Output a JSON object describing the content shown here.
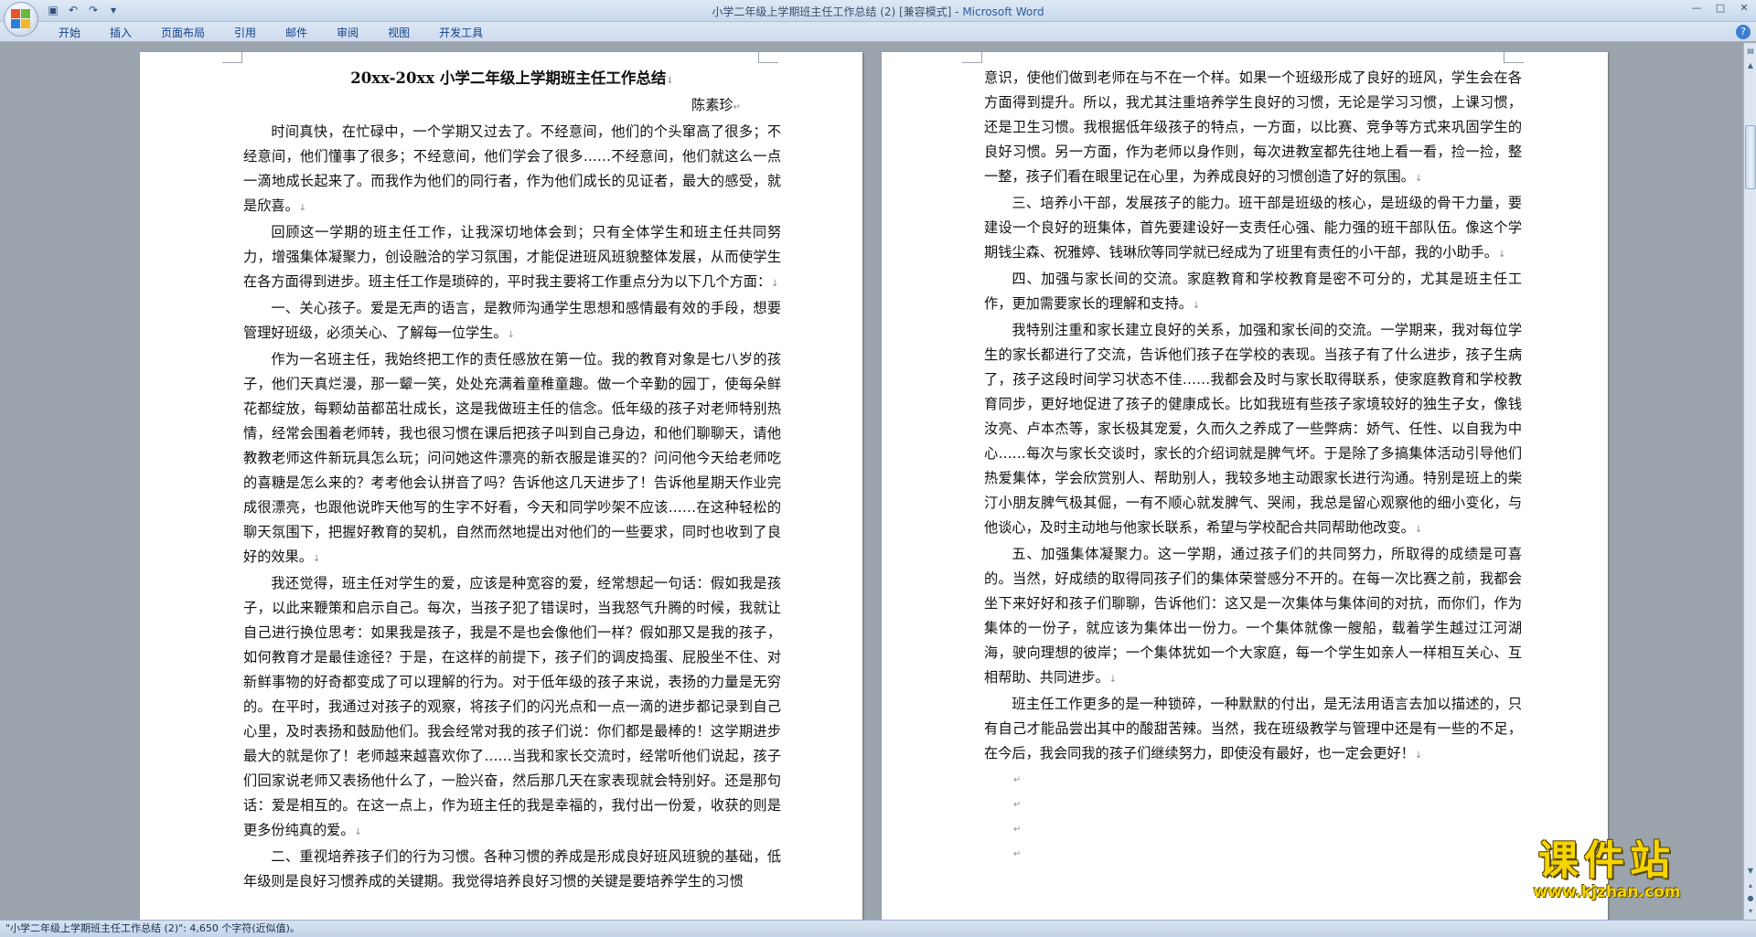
{
  "window": {
    "title_doc": "小学二年级上学期班主任工作总结 (2) [兼容模式] - ",
    "title_app": "Microsoft Word"
  },
  "ribbon": {
    "tabs": [
      "开始",
      "插入",
      "页面布局",
      "引用",
      "邮件",
      "审阅",
      "视图",
      "开发工具"
    ]
  },
  "document": {
    "title": "20xx-20xx 小学二年级上学期班主任工作总结",
    "author": "陈素珍",
    "left_paragraphs": [
      {
        "text": "时间真快，在忙碌中，一个学期又过去了。不经意间，他们的个头窜高了很多；不经意间，他们懂事了很多；不经意间，他们学会了很多……不经意间，他们就这么一点一滴地成长起来了。而我作为他们的同行者，作为他们成长的见证者，最大的感受，就是欣喜。",
        "indent": true
      },
      {
        "text": "回顾这一学期的班主任工作，让我深切地体会到；只有全体学生和班主任共同努力，增强集体凝聚力，创设融洽的学习氛围，才能促进班风班貌整体发展，从而使学生在各方面得到进步。班主任工作是琐碎的，平时我主要将工作重点分为以下几个方面：",
        "indent": true
      },
      {
        "text": "一、关心孩子。爱是无声的语言，是教师沟通学生思想和感情最有效的手段，想要管理好班级，必须关心、了解每一位学生。",
        "indent": true
      },
      {
        "text": "作为一名班主任，我始终把工作的责任感放在第一位。我的教育对象是七八岁的孩子，他们天真烂漫，那一颦一笑，处处充满着童稚童趣。做一个辛勤的园丁，使每朵鲜花都绽放，每颗幼苗都茁壮成长，这是我做班主任的信念。低年级的孩子对老师特别热情，经常会围着老师转，我也很习惯在课后把孩子叫到自己身边，和他们聊聊天，请他教教老师这件新玩具怎么玩；问问她这件漂亮的新衣服是谁买的？问问他今天给老师吃的喜糖是怎么来的？考考他会认拼音了吗？告诉他这几天进步了！告诉他星期天作业完成很漂亮，也跟他说昨天他写的生字不好看，今天和同学吵架不应该……在这种轻松的聊天氛围下，把握好教育的契机，自然而然地提出对他们的一些要求，同时也收到了良好的效果。",
        "indent": true
      },
      {
        "text": "我还觉得，班主任对学生的爱，应该是种宽容的爱，经常想起一句话：假如我是孩子，以此来鞭策和启示自己。每次，当孩子犯了错误时，当我怒气升腾的时候，我就让自己进行换位思考：如果我是孩子，我是不是也会像他们一样？假如那又是我的孩子，如何教育才是最佳途径？于是，在这样的前提下，孩子们的调皮捣蛋、屁股坐不住、对新鲜事物的好奇都变成了可以理解的行为。对于低年级的孩子来说，表扬的力量是无穷的。在平时，我通过对孩子的观察，将孩子们的闪光点和一点一滴的进步都记录到自己心里，及时表扬和鼓励他们。我会经常对我的孩子们说：你们都是最棒的！这学期进步最大的就是你了！老师越来越喜欢你了……当我和家长交流时，经常听他们说起，孩子们回家说老师又表扬他什么了，一脸兴奋，然后那几天在家表现就会特别好。还是那句话：爱是相互的。在这一点上，作为班主任的我是幸福的，我付出一份爱，收获的则是更多份纯真的爱。",
        "indent": true
      },
      {
        "text": "二、重视培养孩子们的行为习惯。各种习惯的养成是形成良好班风班貌的基础，低年级则是良好习惯养成的关键期。我觉得培养良好习惯的关键是要培养学生的习惯",
        "indent": true,
        "no_mark": true
      }
    ],
    "right_paragraphs": [
      {
        "text": "意识，使他们做到老师在与不在一个样。如果一个班级形成了良好的班风，学生会在各方面得到提升。所以，我尤其注重培养学生良好的习惯，无论是学习习惯，上课习惯，还是卫生习惯。我根据低年级孩子的特点，一方面，以比赛、竞争等方式来巩固学生的良好习惯。另一方面，作为老师以身作则，每次进教室都先往地上看一看，捡一捡，整一整，孩子们看在眼里记在心里，为养成良好的习惯创造了好的氛围。",
        "indent": false
      },
      {
        "text": "三、培养小干部，发展孩子的能力。班干部是班级的核心，是班级的骨干力量，要建设一个良好的班集体，首先要建设好一支责任心强、能力强的班干部队伍。像这个学期钱尘森、祝雅婷、钱琳欣等同学就已经成为了班里有责任的小干部，我的小助手。",
        "indent": true
      },
      {
        "text": "四、加强与家长间的交流。家庭教育和学校教育是密不可分的，尤其是班主任工作，更加需要家长的理解和支持。",
        "indent": true
      },
      {
        "text": "我特别注重和家长建立良好的关系，加强和家长间的交流。一学期来，我对每位学生的家长都进行了交流，告诉他们孩子在学校的表现。当孩子有了什么进步，孩子生病了，孩子这段时间学习状态不佳……我都会及时与家长取得联系，使家庭教育和学校教育同步，更好地促进了孩子的健康成长。比如我班有些孩子家境较好的独生子女，像钱汝亮、卢本杰等，家长极其宠爱，久而久之养成了一些弊病：娇气、任性、以自我为中心……每次与家长交谈时，家长的介绍词就是脾气坏。于是除了多搞集体活动引导他们热爱集体，学会欣赏别人、帮助别人，我较多地主动跟家长进行沟通。特别是班上的柴汀小朋友脾气极其倔，一有不顺心就发脾气、哭闹，我总是留心观察他的细小变化，与他谈心，及时主动地与他家长联系，希望与学校配合共同帮助他改变。",
        "indent": true
      },
      {
        "text": "五、加强集体凝聚力。这一学期，通过孩子们的共同努力，所取得的成绩是可喜的。当然，好成绩的取得同孩子们的集体荣誉感分不开的。在每一次比赛之前，我都会坐下来好好和孩子们聊聊，告诉他们：这又是一次集体与集体间的对抗，而你们，作为集体的一份子，就应该为集体出一份力。一个集体就像一艘船，载着学生越过江河湖海，驶向理想的彼岸；一个集体犹如一个大家庭，每一个学生如亲人一样相互关心、互相帮助、共同进步。",
        "indent": true
      },
      {
        "text": "班主任工作更多的是一种锁碎，一种默默的付出，是无法用语言去加以描述的，只有自己才能品尝出其中的酸甜苦辣。当然，我在班级教学与管理中还是有一些的不足，在今后，我会同我的孩子们继续努力，即使没有最好，也一定会更好！",
        "indent": true
      }
    ],
    "paragraph_mark": "↵",
    "heading_mark": "↓",
    "empty_paragraphs": 4
  },
  "statusbar": {
    "text": "\"小学二年级上学期班主任工作总结 (2)\": 4,650 个字符(近似值)。"
  },
  "watermark": {
    "big": "课件站",
    "url": "www.kjzhan.com"
  }
}
